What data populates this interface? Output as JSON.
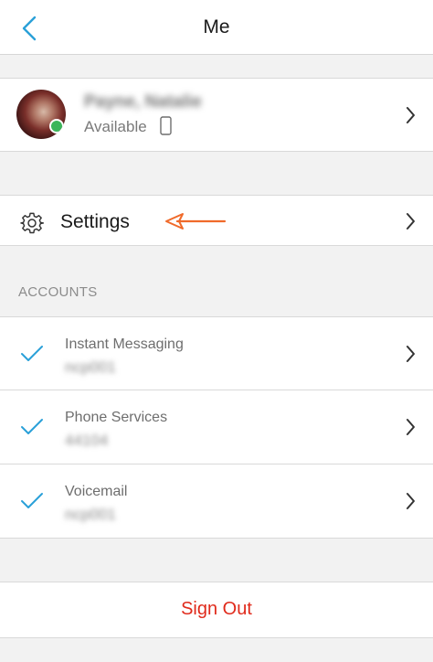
{
  "header": {
    "title": "Me"
  },
  "profile": {
    "name": "Payne, Natalie",
    "status": "Available"
  },
  "settings": {
    "label": "Settings"
  },
  "accounts": {
    "heading": "ACCOUNTS",
    "items": [
      {
        "title": "Instant Messaging",
        "subtitle": "ncp001"
      },
      {
        "title": "Phone Services",
        "subtitle": "44104"
      },
      {
        "title": "Voicemail",
        "subtitle": "ncp001"
      }
    ]
  },
  "footer": {
    "sign_out_label": "Sign Out"
  },
  "colors": {
    "accent": "#2aa0d8",
    "annotation_arrow": "#f06a2a",
    "sign_out": "#e02a1b"
  },
  "icons": [
    "back-chevron-icon",
    "mobile-phone-icon",
    "gear-icon",
    "arrow-left-annotation-icon",
    "checkmark-icon",
    "chevron-right-icon"
  ]
}
